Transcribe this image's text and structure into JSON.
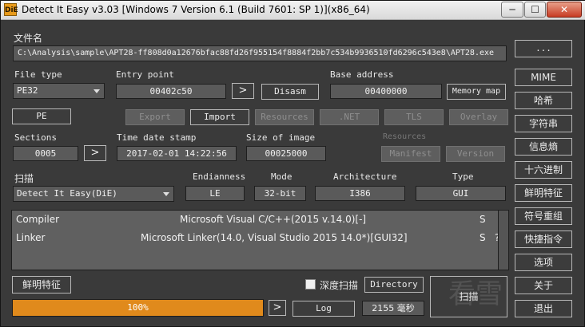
{
  "window": {
    "title": "Detect It Easy v3.03 [Windows 7 Version 6.1 (Build 7601: SP 1)](x86_64)",
    "icon_text": "DiE",
    "minimize": "─",
    "maximize": "☐",
    "close": "✕"
  },
  "file": {
    "label": "文件名",
    "path": "C:\\Analysis\\sample\\APT28-ff808d0a12676bfac88fd26f955154f8884f2bb7c534b9936510fd6296c543e8\\APT28.exe",
    "browse": "..."
  },
  "file_type": {
    "label": "File type",
    "value": "PE32"
  },
  "entry_point": {
    "label": "Entry point",
    "value": "00402c50",
    "go": ">",
    "disasm": "Disasm"
  },
  "base_address": {
    "label": "Base address",
    "value": "00400000",
    "memory_map": "Memory map"
  },
  "pe_buttons": {
    "pe": "PE",
    "export": "Export",
    "import": "Import",
    "resources": "Resources",
    "net": ".NET",
    "tls": "TLS",
    "overlay": "Overlay"
  },
  "sections": {
    "label": "Sections",
    "value": "0005",
    "go": ">"
  },
  "timestamp": {
    "label": "Time date stamp",
    "value": "2017-02-01 14:22:56"
  },
  "image_size": {
    "label": "Size of image",
    "value": "00025000"
  },
  "resources_group": {
    "label": "Resources",
    "manifest": "Manifest",
    "version": "Version"
  },
  "scan": {
    "label": "扫描",
    "engine": "Detect It Easy(DiE)",
    "endianness_label": "Endianness",
    "endianness": "LE",
    "mode_label": "Mode",
    "mode": "32-bit",
    "arch_label": "Architecture",
    "arch": "I386",
    "type_label": "Type",
    "type": "GUI"
  },
  "results": [
    {
      "kind": "Compiler",
      "name": "Microsoft Visual C/C++(2015 v.14.0)[-]",
      "flag": "S",
      "extra": ""
    },
    {
      "kind": "Linker",
      "name": "Microsoft Linker(14.0, Visual Studio 2015 14.0*)[GUI32]",
      "flag": "S",
      "extra": "?"
    }
  ],
  "bottom": {
    "signatures": "鲜明特征",
    "deep_scan": "深度扫描",
    "directory": "Directory",
    "progress_text": "100%",
    "progress": 1.0,
    "go": ">",
    "log": "Log",
    "time": "2155 毫秒",
    "scan": "扫描"
  },
  "side": [
    "MIME",
    "哈希",
    "字符串",
    "信息熵",
    "十六进制",
    "鲜明特征",
    "符号重组",
    "快捷指令",
    "选项",
    "关于",
    "退出"
  ],
  "watermark": "看雪"
}
